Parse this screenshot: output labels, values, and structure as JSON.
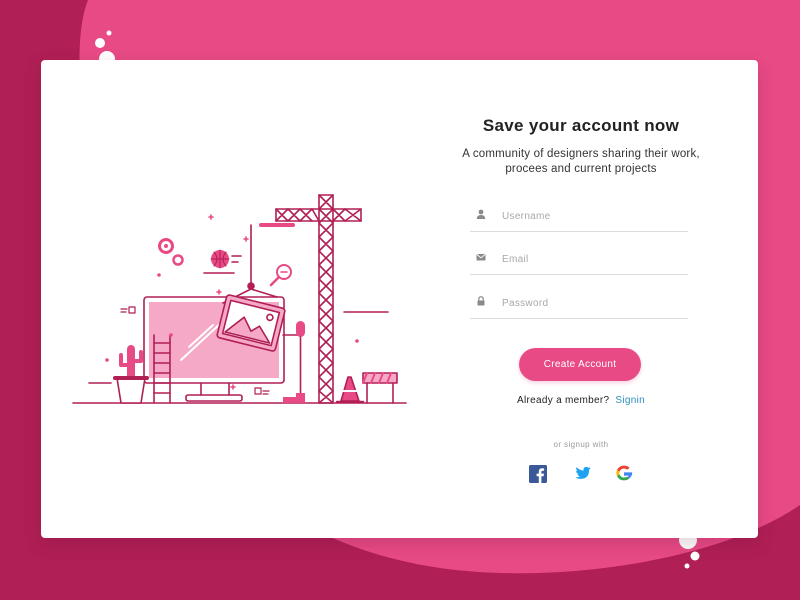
{
  "colors": {
    "background_dark": "#b01f56",
    "background_pink": "#e84a86",
    "card": "#ffffff",
    "accent": "#e84a86",
    "link": "#2b8fbd"
  },
  "form": {
    "title": "Save your account now",
    "subtitle_line1": "A community of designers sharing their work,",
    "subtitle_line2": "procees and current projects",
    "fields": [
      {
        "icon": "user-icon",
        "placeholder": "Username",
        "value": ""
      },
      {
        "icon": "envelope-icon",
        "placeholder": "Email",
        "value": ""
      },
      {
        "icon": "lock-icon",
        "placeholder": "Password",
        "value": ""
      }
    ],
    "submit_label": "Create Account",
    "member_prompt": "Already a member?",
    "signin_label": "Signin",
    "or_signup_label": "or signup with",
    "social": [
      "facebook-icon",
      "twitter-icon",
      "google-icon"
    ]
  },
  "illustration": {
    "subject": "construction-crane-over-monitor",
    "icons": [
      "gear-icon",
      "basketball-icon",
      "magnifier-icon",
      "cactus-icon",
      "traffic-cone-icon",
      "barrier-icon",
      "ladder-icon",
      "image-icon"
    ]
  }
}
